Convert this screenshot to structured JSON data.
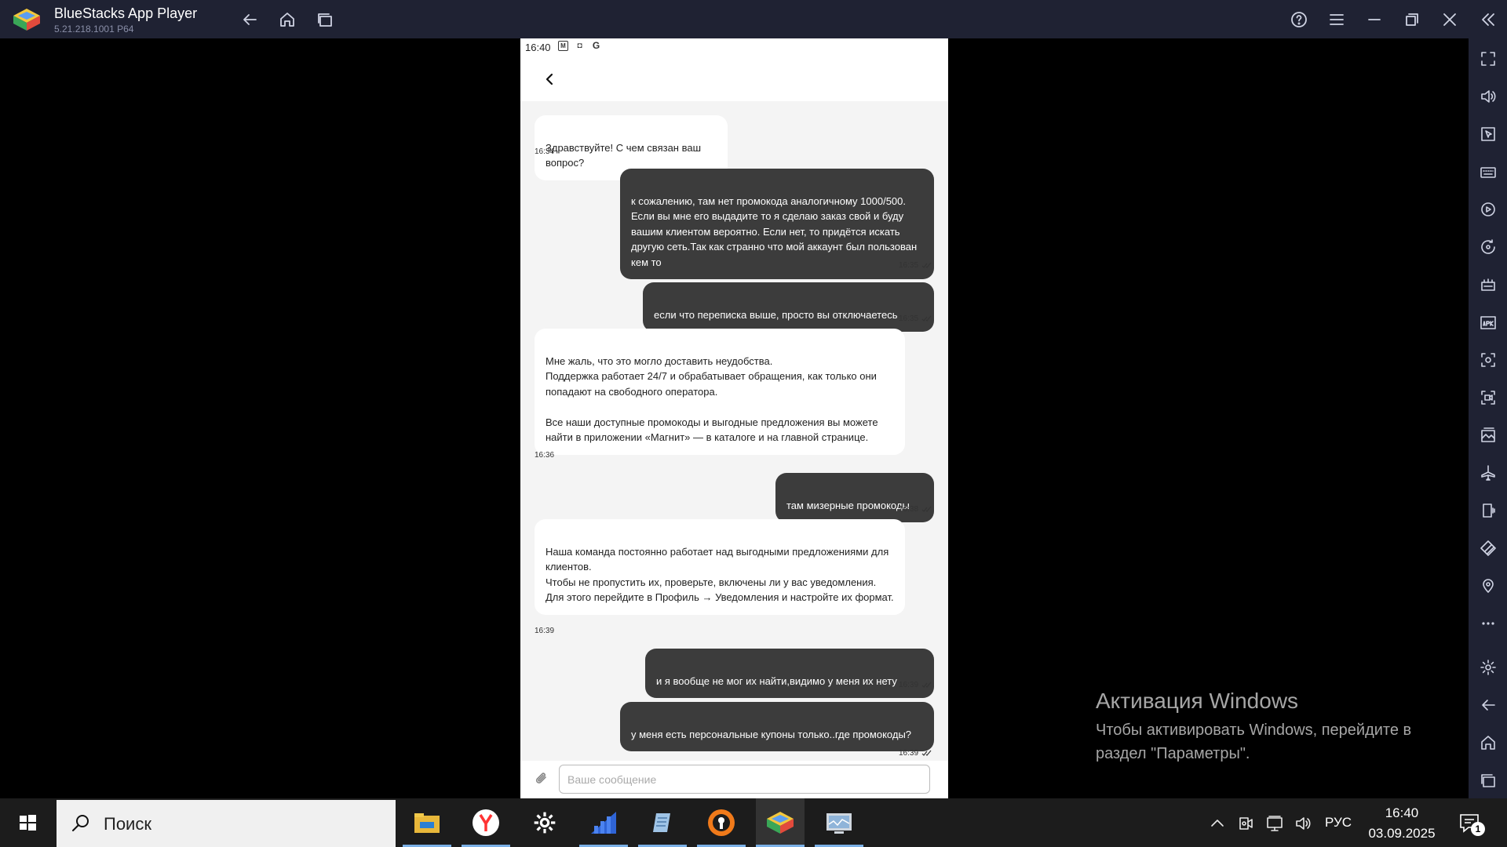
{
  "window": {
    "title": "BlueStacks App Player",
    "version": "5.21.218.1001  P64"
  },
  "phone": {
    "status_time": "16:40",
    "status_icons": [
      "m-icon",
      "notification-icon",
      "google-icon"
    ],
    "messages": [
      {
        "dir": "in",
        "text": "Здравствуйте! С чем связан ваш вопрос?",
        "time": "16:34"
      },
      {
        "dir": "out",
        "text": "к сожалению, там нет промокода аналогичному 1000/500. Если вы мне его выдадите то я сделаю заказ свой и буду вашим клиентом вероятно. Если нет, то придётся искать другую сеть.Так как странно что мой аккаунт был пользован кем то",
        "time": "16:35"
      },
      {
        "dir": "out",
        "text": "если что переписка выше, просто вы отключаетесь",
        "time": "16:35"
      },
      {
        "dir": "in",
        "text": "Мне жаль, что это могло доставить неудобства.\nПоддержка работает 24/7 и обрабатывает обращения, как только они попадают на свободного оператора.\n\nВсе наши доступные промокоды и выгодные предложения вы можете найти в приложении «Магнит» — в каталоге и на главной странице.",
        "time": "16:36"
      },
      {
        "dir": "out",
        "text": "там мизерные промокоды",
        "time": "16:38"
      },
      {
        "dir": "in",
        "text": "Наша команда постоянно работает над выгодными предложениями для клиентов.\nЧтобы не пропустить их, проверьте, включены ли у вас уведомления.\nДля этого перейдите в Профиль → Уведомления и настройте их формат.",
        "time": "16:39"
      },
      {
        "dir": "out",
        "text": "и я вообще не мог их найти,видимо у меня их нету",
        "time": "16:39"
      },
      {
        "dir": "out",
        "text": "у меня есть персональные купоны только..где промокоды?",
        "time": "16:39"
      }
    ],
    "composer": {
      "placeholder": "Ваше сообщение",
      "value": ""
    }
  },
  "activation": {
    "title": "Активация Windows",
    "line1": "Чтобы активировать Windows, перейдите в",
    "line2": "раздел \"Параметры\"."
  },
  "taskbar": {
    "search_placeholder": "Поиск",
    "lang": "РУС",
    "time": "16:40",
    "date": "03.09.2025",
    "notifications": "1"
  },
  "colors": {
    "titlebar": "#1f2233",
    "bubble_out": "#3c3c3c",
    "bubble_in": "#ffffff",
    "chat_bg": "#f4f4f4"
  }
}
